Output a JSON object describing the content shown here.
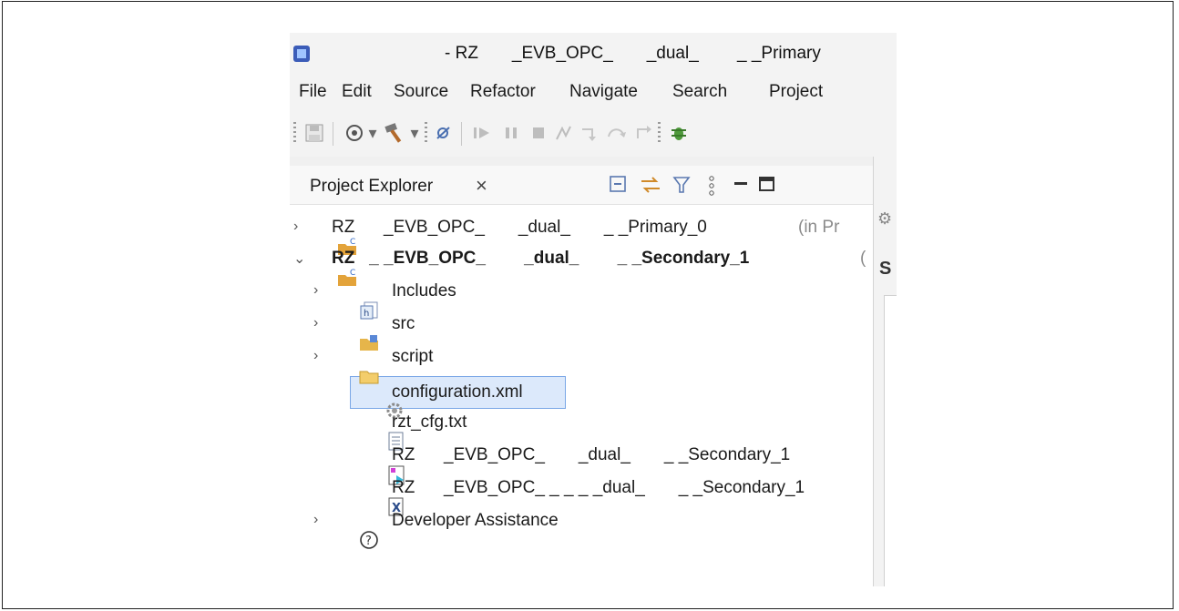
{
  "window": {
    "title": "- RZ       _EVB_OPC_       _dual_        _ _Primary"
  },
  "menu": {
    "items": [
      "File",
      "Edit",
      "Source",
      "Refactor",
      "Navigate",
      "Search",
      "Project"
    ]
  },
  "toolbar": {
    "icons": [
      "save-icon",
      "build-config-icon",
      "dropdown-icon",
      "hammer-build-icon",
      "dropdown-icon",
      "debug-skip-icon",
      "resume-icon",
      "suspend-icon",
      "terminate-icon",
      "connect-icon",
      "step-into-icon",
      "step-over-icon",
      "step-return-icon",
      "bug-debug-icon"
    ]
  },
  "explorer": {
    "tab_label": "Project Explorer",
    "close_symbol": "×",
    "header_icons": [
      "collapse-all-icon",
      "link-editor-icon",
      "filter-icon",
      "view-menu-icon",
      "minimize-icon",
      "maximize-icon"
    ]
  },
  "tree": {
    "project_primary": {
      "label": "RZ      _EVB_OPC_       _dual_       _ _Primary_0",
      "suffix": "(in Pr"
    },
    "project_secondary": {
      "label": "RZ   _ _EVB_OPC_        _dual_        _ _Secondary_1",
      "suffix": "("
    },
    "children": [
      {
        "label": "Includes",
        "icon": "includes-icon",
        "expandable": true
      },
      {
        "label": "src",
        "icon": "source-folder-icon",
        "expandable": true
      },
      {
        "label": "script",
        "icon": "folder-icon",
        "expandable": true
      },
      {
        "label": "configuration.xml",
        "icon": "gear-config-icon",
        "expandable": false,
        "selected": true
      },
      {
        "label": "rzt_cfg.txt",
        "icon": "text-file-icon",
        "expandable": false
      },
      {
        "label": "RZ      _EVB_OPC_       _dual_       _ _Secondary_1",
        "icon": "launch-file-icon",
        "expandable": false
      },
      {
        "label": "RZ      _EVB_OPC_ _ _ _ _dual_       _ _Secondary_1",
        "icon": "x-file-icon",
        "expandable": false
      },
      {
        "label": "Developer Assistance",
        "icon": "help-icon",
        "expandable": true
      }
    ]
  },
  "colors": {
    "selection_bg": "#dce9fb",
    "selection_border": "#7aa7e6",
    "project_icon": "#e3a33a",
    "folder_icon": "#e6b54a"
  },
  "right_panel": {
    "tab_fragment": "S"
  }
}
